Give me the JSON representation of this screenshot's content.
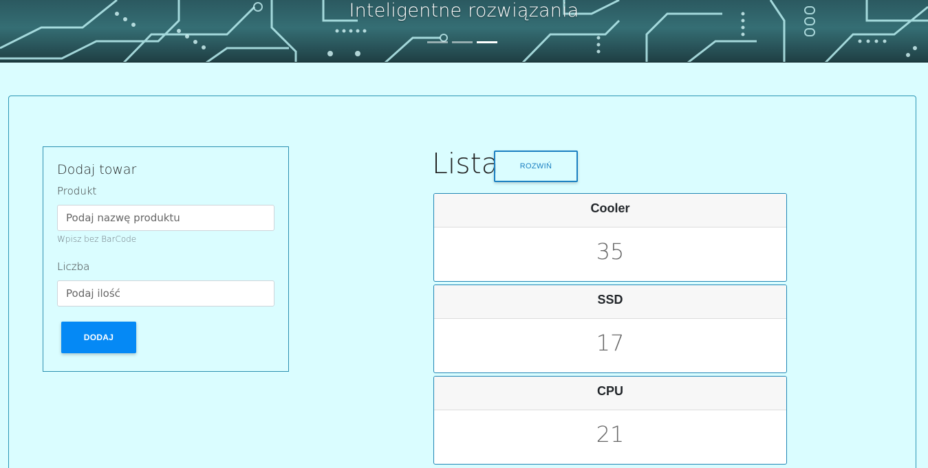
{
  "hero": {
    "caption": "Inteligentne rozwiązania",
    "slides": 3,
    "active_slide": 3
  },
  "form": {
    "title": "Dodaj towar",
    "product_label": "Produkt",
    "product_placeholder": "Podaj nazwę produktu",
    "product_value": "",
    "product_hint": "Wpisz bez BarCode",
    "quantity_label": "Liczba",
    "quantity_placeholder": "Podaj ilość",
    "quantity_value": "",
    "submit_label": "DODAJ"
  },
  "list": {
    "title": "Lista",
    "expand_label": "ROZWIŃ",
    "items": [
      {
        "name": "Cooler",
        "count": "35"
      },
      {
        "name": "SSD",
        "count": "17"
      },
      {
        "name": "CPU",
        "count": "21"
      }
    ]
  },
  "colors": {
    "page_background": "#dafdff",
    "primary_button": "#0589f5",
    "border_accent": "#2a95b4",
    "outline_button": "#1a7fc1"
  }
}
